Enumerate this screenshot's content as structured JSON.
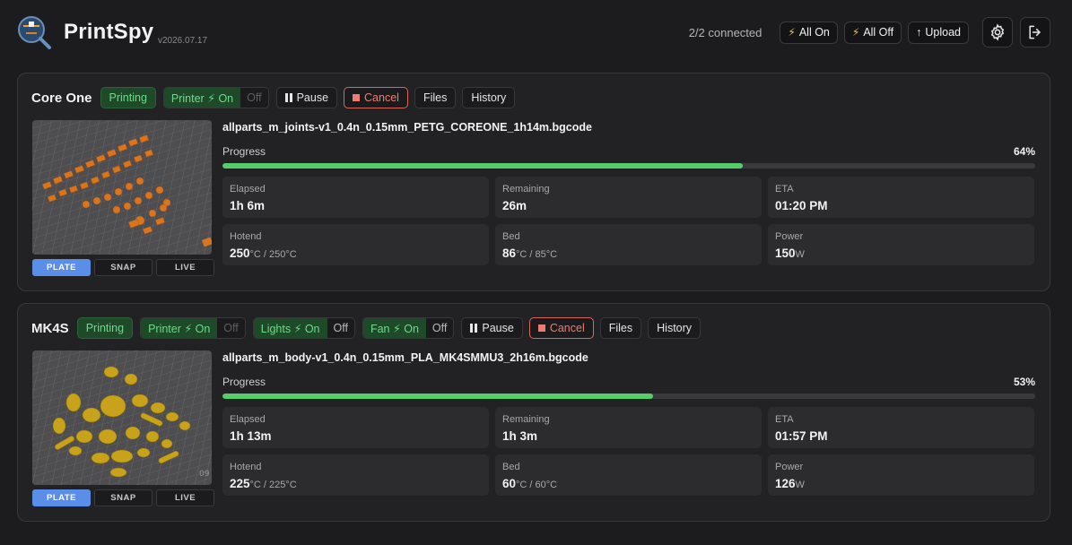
{
  "app": {
    "name": "PrintSpy",
    "version": "v2026.07.17"
  },
  "header": {
    "connected": "2/2 connected",
    "all_on": "All On",
    "all_off": "All Off",
    "upload": "Upload"
  },
  "icons": {
    "bolt": "⚡",
    "upload_arrow": "↑",
    "settings": "gear-icon",
    "logout": "logout-icon"
  },
  "colors": {
    "accent_green": "#56cd6a",
    "badge_green": "#6fd98a",
    "cancel_red": "#ee7c70",
    "active_tab_blue": "#5a8ee8"
  },
  "printers": [
    {
      "name": "Core One",
      "status": "Printing",
      "printer_toggle": {
        "on": "Printer ⚡ On",
        "off": "Off"
      },
      "actions": {
        "pause": "Pause",
        "cancel": "Cancel",
        "files": "Files",
        "history": "History"
      },
      "view_tabs": [
        "PLATE",
        "SNAP",
        "LIVE"
      ],
      "file": "allparts_m_joints-v1_0.4n_0.15mm_PETG_COREONE_1h14m.bgcode",
      "progress_label": "Progress",
      "progress_pct": "64%",
      "progress": 64,
      "stats": {
        "elapsed": {
          "label": "Elapsed",
          "value": "1h 6m"
        },
        "remaining": {
          "label": "Remaining",
          "value": "26m"
        },
        "eta": {
          "label": "ETA",
          "value": "01:20 PM"
        },
        "hotend": {
          "label": "Hotend",
          "value": "250",
          "unit": "°C / 250°C"
        },
        "bed": {
          "label": "Bed",
          "value": "86",
          "unit": "°C / 85°C"
        },
        "power": {
          "label": "Power",
          "value": "150",
          "unit": "W"
        }
      }
    },
    {
      "name": "MK4S",
      "status": "Printing",
      "printer_toggle": {
        "on": "Printer ⚡ On",
        "off": "Off"
      },
      "lights_toggle": {
        "on": "Lights ⚡ On",
        "off": "Off"
      },
      "fan_toggle": {
        "on": "Fan ⚡ On",
        "off": "Off"
      },
      "actions": {
        "pause": "Pause",
        "cancel": "Cancel",
        "files": "Files",
        "history": "History"
      },
      "view_tabs": [
        "PLATE",
        "SNAP",
        "LIVE"
      ],
      "file": "allparts_m_body-v1_0.4n_0.15mm_PLA_MK4SMMU3_2h16m.bgcode",
      "progress_label": "Progress",
      "progress_pct": "53%",
      "progress": 53,
      "stats": {
        "elapsed": {
          "label": "Elapsed",
          "value": "1h 13m"
        },
        "remaining": {
          "label": "Remaining",
          "value": "1h 3m"
        },
        "eta": {
          "label": "ETA",
          "value": "01:57 PM"
        },
        "hotend": {
          "label": "Hotend",
          "value": "225",
          "unit": "°C / 225°C"
        },
        "bed": {
          "label": "Bed",
          "value": "60",
          "unit": "°C / 60°C"
        },
        "power": {
          "label": "Power",
          "value": "126",
          "unit": "W"
        }
      }
    }
  ]
}
